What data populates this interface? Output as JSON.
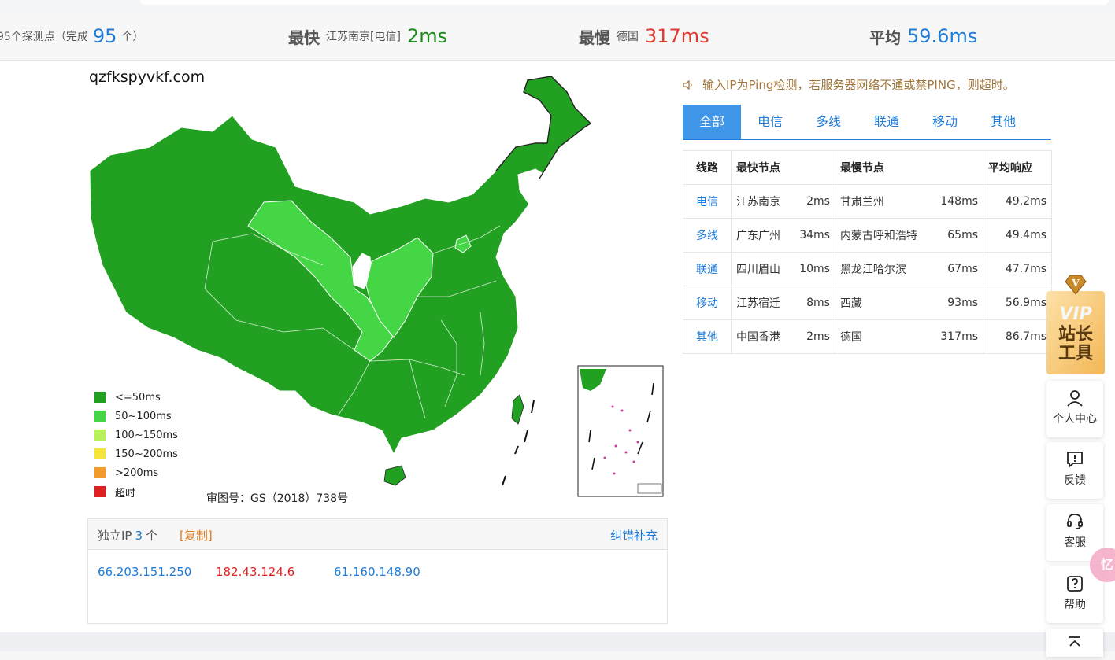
{
  "summary": {
    "probes_prefix": "95个探测点（完成",
    "probes_count": "95",
    "probes_suffix": "个）",
    "fastest_label": "最快",
    "fastest_node": "江苏南京[电信]",
    "fastest_value": "2ms",
    "slowest_label": "最慢",
    "slowest_node": "德国",
    "slowest_value": "317ms",
    "average_label": "平均",
    "average_value": "59.6ms"
  },
  "map": {
    "domain": "qzfkspyvkf.com",
    "review_number": "审图号：GS（2018）738号",
    "legend": [
      {
        "label": "<=50ms",
        "color": "#22a022"
      },
      {
        "label": "50~100ms",
        "color": "#45d645"
      },
      {
        "label": "100~150ms",
        "color": "#b7f25a"
      },
      {
        "label": "150~200ms",
        "color": "#f5e53c"
      },
      {
        "label": ">200ms",
        "color": "#f29a2e"
      },
      {
        "label": "超时",
        "color": "#e02020"
      }
    ]
  },
  "ip": {
    "label": "独立IP",
    "count": "3",
    "unit": "个",
    "copy": "[复制]",
    "fix": "纠错补充",
    "addresses": [
      {
        "ip": "66.203.151.250",
        "color": "#1f7bd8"
      },
      {
        "ip": "182.43.124.6",
        "color": "#e02020"
      },
      {
        "ip": "61.160.148.90",
        "color": "#1f7bd8"
      }
    ]
  },
  "notice": "输入IP为Ping检测，若服务器网络不通或禁PING，则超时。",
  "tabs": [
    {
      "label": "全部",
      "active": true
    },
    {
      "label": "电信",
      "active": false
    },
    {
      "label": "多线",
      "active": false
    },
    {
      "label": "联通",
      "active": false
    },
    {
      "label": "移动",
      "active": false
    },
    {
      "label": "其他",
      "active": false
    }
  ],
  "table": {
    "headers": [
      "线路",
      "最快节点",
      "最慢节点",
      "平均响应"
    ],
    "rows": [
      {
        "line": "电信",
        "fast_node": "江苏南京",
        "fast_ms": "2ms",
        "slow_node": "甘肃兰州",
        "slow_ms": "148ms",
        "avg": "49.2ms"
      },
      {
        "line": "多线",
        "fast_node": "广东广州",
        "fast_ms": "34ms",
        "slow_node": "内蒙古呼和浩特",
        "slow_ms": "65ms",
        "avg": "49.4ms"
      },
      {
        "line": "联通",
        "fast_node": "四川眉山",
        "fast_ms": "10ms",
        "slow_node": "黑龙江哈尔滨",
        "slow_ms": "67ms",
        "avg": "47.7ms"
      },
      {
        "line": "移动",
        "fast_node": "江苏宿迁",
        "fast_ms": "8ms",
        "slow_node": "西藏",
        "slow_ms": "93ms",
        "avg": "56.9ms"
      },
      {
        "line": "其他",
        "fast_node": "中国香港",
        "fast_ms": "2ms",
        "slow_node": "德国",
        "slow_ms": "317ms",
        "avg": "86.7ms"
      }
    ]
  },
  "sidebar": {
    "vip_badge": "V",
    "vip_line1": "VIP",
    "vip_line2": "站长",
    "vip_line3": "工具",
    "buttons": [
      {
        "label": "个人中心",
        "icon": "user-icon"
      },
      {
        "label": "反馈",
        "icon": "feedback-icon"
      },
      {
        "label": "客服",
        "icon": "headset-icon"
      },
      {
        "label": "帮助",
        "icon": "help-icon"
      }
    ],
    "pink_text": "忆"
  },
  "colors": {
    "accent": "#1f7bd8",
    "fast": "#1a8a1a",
    "slow": "#e03a2f",
    "notice": "#a0763a"
  }
}
